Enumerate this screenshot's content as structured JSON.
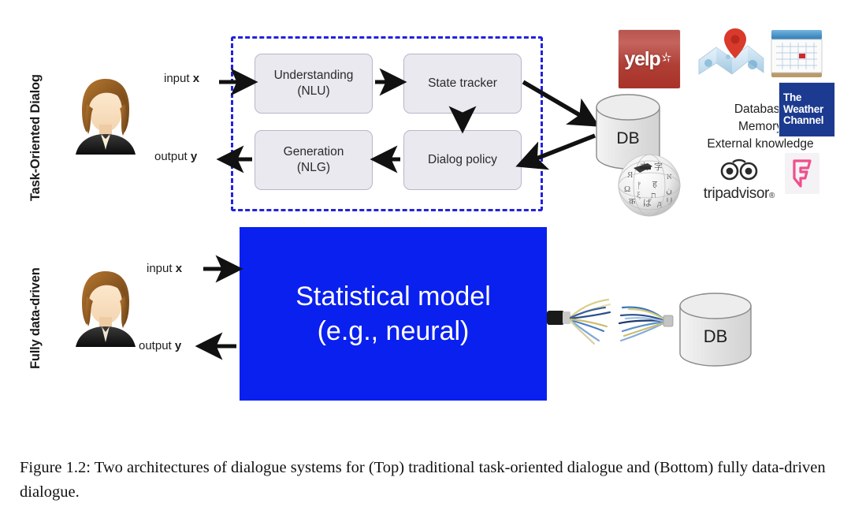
{
  "figure": {
    "caption": "Figure 1.2: Two architectures of dialogue systems for (Top) traditional task-oriented dialogue and (Bottom) fully data-driven dialogue."
  },
  "colors": {
    "dashed_border": "#2222dd",
    "module_fill": "#e9e9ef",
    "module_border": "#b7b7cc",
    "statistical_model_blue": "#0a20ef",
    "yelp_red": "#af3f36",
    "weather_channel_navy": "#1c3a8f",
    "foursquare_pink": "#f04e8c",
    "map_pin_red": "#d93a2b",
    "arrow_black": "#111111",
    "text_dark": "#1e1e1e"
  },
  "top_section": {
    "row_label": "Task-Oriented Dialog",
    "user_avatar": "woman-avatar-icon",
    "io": {
      "input_label_prefix": "input ",
      "input_label_var": "x",
      "output_label_prefix": "output ",
      "output_label_var": "y"
    },
    "modules": [
      {
        "name": "nlu",
        "line1": "Understanding",
        "line2": "(NLU)"
      },
      {
        "name": "state-tracker",
        "line1": "State tracker",
        "line2": ""
      },
      {
        "name": "dialog-policy",
        "line1": "Dialog policy",
        "line2": ""
      },
      {
        "name": "nlg",
        "line1": "Generation",
        "line2": "(NLG)"
      }
    ],
    "database": {
      "label": "DB",
      "icon": "database-cylinder-icon"
    },
    "knowledge_lines": [
      "Database",
      "Memory",
      "External knowledge"
    ],
    "logos": [
      {
        "name": "yelp-logo",
        "text": "yelp",
        "icon": "yelp-burst-icon"
      },
      {
        "name": "map-logo",
        "text": "",
        "icon": "folded-map-pin-icon"
      },
      {
        "name": "calendar-logo",
        "text": "",
        "icon": "calendar-icon"
      },
      {
        "name": "weather-channel-logo",
        "line1": "The",
        "line2": "Weather",
        "line3": "Channel",
        "icon": "weather-channel-icon"
      },
      {
        "name": "wikipedia-logo",
        "text": "",
        "icon": "wikipedia-globe-icon"
      },
      {
        "name": "tripadvisor-logo",
        "text": "tripadvisor",
        "registered": "®",
        "icon": "tripadvisor-owl-icon"
      },
      {
        "name": "foursquare-logo",
        "text": "",
        "icon": "foursquare-f-icon"
      }
    ]
  },
  "bottom_section": {
    "row_label": "Fully data-driven",
    "user_avatar": "woman-avatar-icon",
    "io": {
      "input_label_prefix": "input ",
      "input_label_var": "x",
      "output_label_prefix": "output ",
      "output_label_var": "y"
    },
    "model_box": {
      "line1": "Statistical model",
      "line2": "(e.g., neural)"
    },
    "cable": "frayed-ethernet-cable-icon",
    "database": {
      "label": "DB",
      "icon": "database-cylinder-icon"
    }
  }
}
